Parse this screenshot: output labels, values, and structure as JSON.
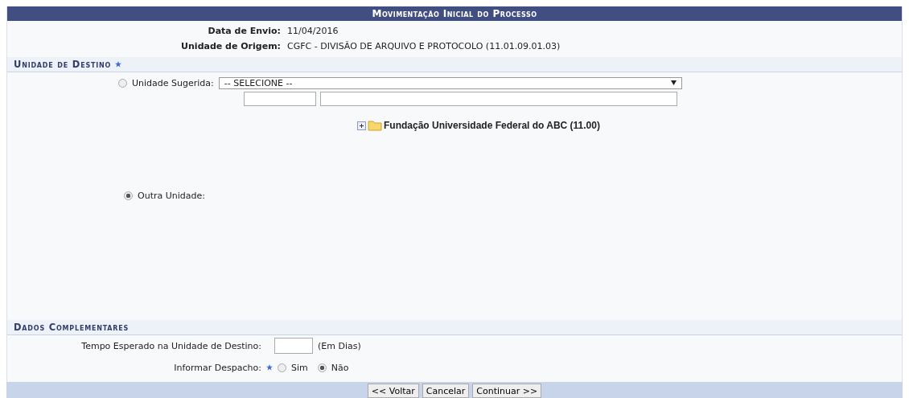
{
  "form_title": "Movimentação Inicial do Processo",
  "info": [
    {
      "label": "Data de Envio:",
      "value": "11/04/2016"
    },
    {
      "label": "Unidade de Origem:",
      "value": "CGFC - DIVISÃO DE ARQUIVO E PROTOCOLO (11.01.09.01.03)"
    }
  ],
  "destino": {
    "heading": "Unidade de Destino",
    "required": true,
    "sugerida": {
      "label": "Unidade Sugerida:",
      "selected": false,
      "select_value": "-- SELECIONE --"
    },
    "tree": [
      {
        "label": "Fundação Universidade Federal do ABC (11.00)",
        "expanded": false
      }
    ],
    "outra": {
      "label": "Outra Unidade:",
      "selected": true
    }
  },
  "complementares": {
    "heading": "Dados Complementares",
    "tempo": {
      "label": "Tempo Esperado na Unidade de Destino:",
      "unit": "(Em Dias)"
    },
    "despacho": {
      "label": "Informar Despacho:",
      "required": true,
      "options": [
        {
          "label": "Sim",
          "selected": false
        },
        {
          "label": "Não",
          "selected": true
        }
      ]
    }
  },
  "buttons": [
    "<< Voltar",
    "Cancelar",
    "Continuar >>"
  ]
}
